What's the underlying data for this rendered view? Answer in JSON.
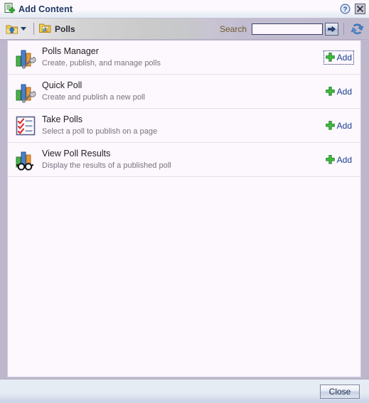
{
  "window": {
    "title": "Add Content",
    "title_icon": "document-add-icon",
    "help_icon": "help-icon",
    "close_icon": "close-icon"
  },
  "toolbar": {
    "up_folder_icon": "folder-up-icon",
    "dropdown_icon": "chevron-down-icon",
    "breadcrumb": {
      "icon": "folder-chart-icon",
      "label": "Polls"
    },
    "search": {
      "label": "Search",
      "value": "",
      "placeholder": "",
      "go_icon": "arrow-right-icon"
    },
    "refresh_icon": "refresh-icon"
  },
  "content": {
    "rows": [
      {
        "icon": "bar-chart-wrench-icon",
        "title": "Polls Manager",
        "description": "Create, publish, and manage polls",
        "action_label": "Add",
        "action_icon": "green-plus-icon",
        "focused": true
      },
      {
        "icon": "bar-chart-wrench-icon",
        "title": "Quick Poll",
        "description": "Create and publish a new poll",
        "action_label": "Add",
        "action_icon": "green-plus-icon",
        "focused": false
      },
      {
        "icon": "checklist-icon",
        "title": "Take Polls",
        "description": "Select a poll to publish on a page",
        "action_label": "Add",
        "action_icon": "green-plus-icon",
        "focused": false
      },
      {
        "icon": "bar-chart-glasses-icon",
        "title": "View Poll Results",
        "description": "Display the results of a published poll",
        "action_label": "Add",
        "action_icon": "green-plus-icon",
        "focused": false
      }
    ]
  },
  "footer": {
    "close_label": "Close"
  },
  "colors": {
    "title_text": "#1f3864",
    "link_blue": "#1b3f8f",
    "accent_green": "#2eaa2e",
    "search_label": "#6b5a2a",
    "panel_bg": "#fdf7fe",
    "window_bg": "#bdb7cb"
  }
}
